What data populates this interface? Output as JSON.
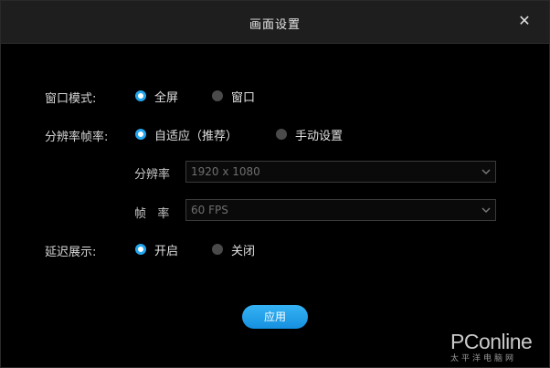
{
  "dialog": {
    "title": "画面设置",
    "close_glyph": "✕"
  },
  "window_mode": {
    "label": "窗口模式:",
    "options": [
      "全屏",
      "窗口"
    ],
    "selected": "全屏"
  },
  "resolution_fps": {
    "label": "分辨率帧率:",
    "options": [
      "自适应（推荐）",
      "手动设置"
    ],
    "selected": "自适应（推荐）",
    "resolution_label": "分辨率",
    "resolution_value": "1920 x 1080",
    "fps_label": "帧   率",
    "fps_value": "60 FPS"
  },
  "delay_display": {
    "label": "延迟展示:",
    "options": [
      "开启",
      "关闭"
    ],
    "selected": "开启"
  },
  "apply_label": "应用",
  "watermark": {
    "logo": "PConline",
    "subtitle": "太平洋电脑网"
  },
  "colors": {
    "accent": "#23a6ee",
    "background": "#000000",
    "titlebar": "#1e1e1e",
    "text": "#e0e0e0",
    "disabled_text": "#6e6e6e"
  },
  "icons": [
    "close-icon",
    "chevron-down-icon"
  ]
}
